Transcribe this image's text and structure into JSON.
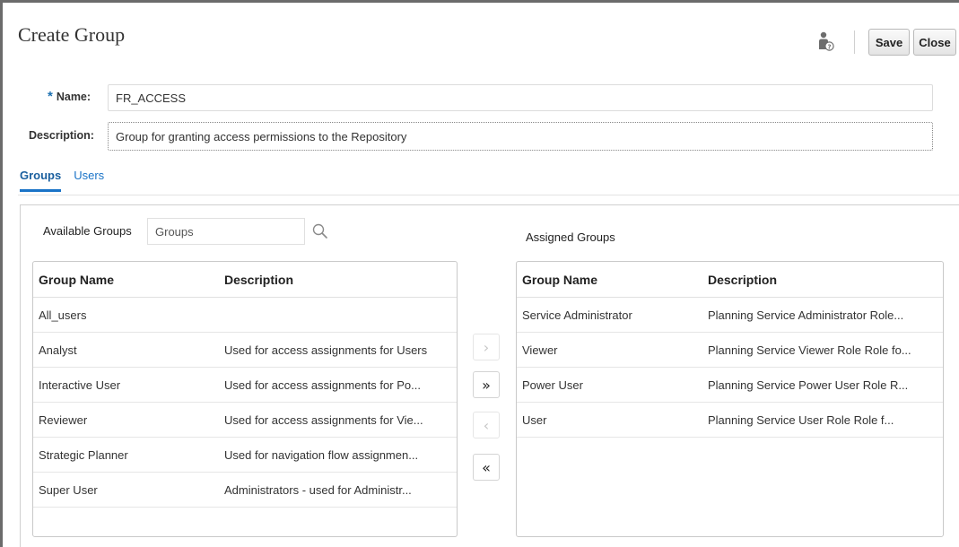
{
  "page": {
    "title": "Create Group"
  },
  "toolbar": {
    "save_label": "Save",
    "close_label": "Close"
  },
  "form": {
    "name_required_marker": "*",
    "name_label": "Name:",
    "name_value": "FR_ACCESS",
    "description_label": "Description:",
    "description_value": "Group for granting access permissions to the Repository"
  },
  "tabs": [
    {
      "label": "Groups",
      "active": true
    },
    {
      "label": "Users",
      "active": false
    }
  ],
  "available": {
    "label": "Available Groups",
    "search_placeholder": "Groups",
    "columns": [
      "Group Name",
      "Description"
    ],
    "rows": [
      {
        "name": "All_users",
        "description": ""
      },
      {
        "name": "Analyst",
        "description": "Used for access assignments for Users"
      },
      {
        "name": "Interactive User",
        "description": "Used for access assignments for Po..."
      },
      {
        "name": "Reviewer",
        "description": "Used for access assignments for Vie..."
      },
      {
        "name": "Strategic Planner",
        "description": "Used for navigation flow assignmen..."
      },
      {
        "name": "Super User",
        "description": "Administrators - used for Administr..."
      }
    ]
  },
  "assigned": {
    "label": "Assigned Groups",
    "columns": [
      "Group Name",
      "Description"
    ],
    "rows": [
      {
        "name": "Service Administrator",
        "description": "Planning Service Administrator Role..."
      },
      {
        "name": "Viewer",
        "description": "Planning Service Viewer Role Role fo..."
      },
      {
        "name": "Power User",
        "description": "Planning Service Power User Role R..."
      },
      {
        "name": "User",
        "description": "Planning Service User  Role Role f..."
      }
    ]
  },
  "shuttle": {
    "move_selected": "›",
    "move_all": "»",
    "remove_selected": "‹",
    "remove_all": "«"
  },
  "icons": {
    "help": "user-help-icon",
    "search": "search-icon"
  }
}
